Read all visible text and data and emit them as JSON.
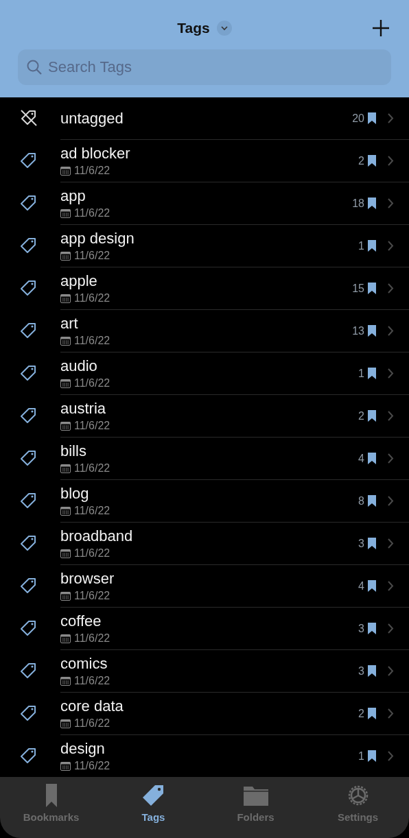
{
  "header": {
    "title": "Tags",
    "search": {
      "placeholder": "Search Tags"
    }
  },
  "tags": [
    {
      "kind": "untagged",
      "name": "untagged",
      "count": "20"
    },
    {
      "kind": "tag",
      "name": "ad blocker",
      "date": "11/6/22",
      "count": "2"
    },
    {
      "kind": "tag",
      "name": "app",
      "date": "11/6/22",
      "count": "18"
    },
    {
      "kind": "tag",
      "name": "app design",
      "date": "11/6/22",
      "count": "1"
    },
    {
      "kind": "tag",
      "name": "apple",
      "date": "11/6/22",
      "count": "15"
    },
    {
      "kind": "tag",
      "name": "art",
      "date": "11/6/22",
      "count": "13"
    },
    {
      "kind": "tag",
      "name": "audio",
      "date": "11/6/22",
      "count": "1"
    },
    {
      "kind": "tag",
      "name": "austria",
      "date": "11/6/22",
      "count": "2"
    },
    {
      "kind": "tag",
      "name": "bills",
      "date": "11/6/22",
      "count": "4"
    },
    {
      "kind": "tag",
      "name": "blog",
      "date": "11/6/22",
      "count": "8"
    },
    {
      "kind": "tag",
      "name": "broadband",
      "date": "11/6/22",
      "count": "3"
    },
    {
      "kind": "tag",
      "name": "browser",
      "date": "11/6/22",
      "count": "4"
    },
    {
      "kind": "tag",
      "name": "coffee",
      "date": "11/6/22",
      "count": "3"
    },
    {
      "kind": "tag",
      "name": "comics",
      "date": "11/6/22",
      "count": "3"
    },
    {
      "kind": "tag",
      "name": "core data",
      "date": "11/6/22",
      "count": "2"
    },
    {
      "kind": "tag",
      "name": "design",
      "date": "11/6/22",
      "count": "1"
    }
  ],
  "tab_bar": [
    {
      "kind": "bookmarks",
      "label": "Bookmarks",
      "selected": false
    },
    {
      "kind": "tags",
      "label": "Tags",
      "selected": true
    },
    {
      "kind": "folders",
      "label": "Folders",
      "selected": false
    },
    {
      "kind": "settings",
      "label": "Settings",
      "selected": false
    }
  ]
}
